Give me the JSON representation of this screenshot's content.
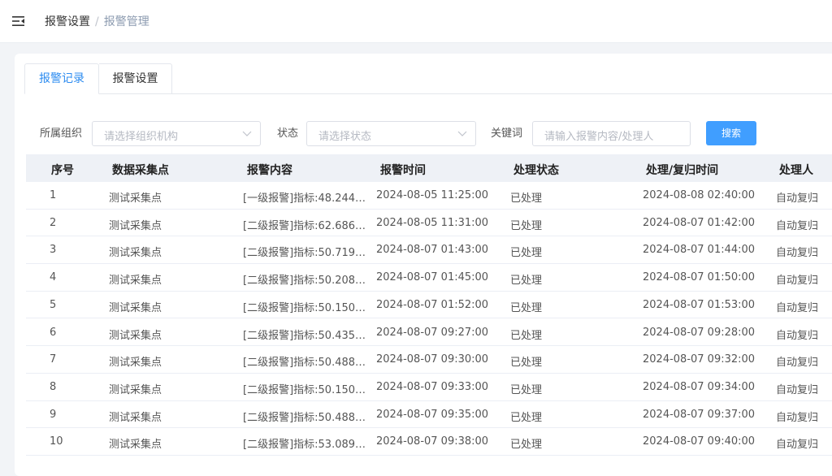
{
  "breadcrumb": {
    "parent": "报警设置",
    "separator": "/",
    "current": "报警管理"
  },
  "tabs": [
    {
      "label": "报警记录",
      "active": true
    },
    {
      "label": "报警设置",
      "active": false
    }
  ],
  "filters": {
    "org_label": "所属组织",
    "org_placeholder": "请选择组织机构",
    "status_label": "状态",
    "status_placeholder": "请选择状态",
    "keyword_label": "关键词",
    "keyword_placeholder": "请输入报警内容/处理人",
    "search_button": "搜索"
  },
  "table": {
    "headers": [
      "序号",
      "数据采集点",
      "报警内容",
      "报警时间",
      "处理状态",
      "处理/复归时间",
      "处理人"
    ],
    "rows": [
      [
        "1",
        "测试采集点",
        "[一级报警]指标:48.244…",
        "2024-08-05 11:25:00",
        "已处理",
        "2024-08-08 02:40:00",
        "自动复归"
      ],
      [
        "2",
        "测试采集点",
        "[二级报警]指标:62.686…",
        "2024-08-05 11:31:00",
        "已处理",
        "2024-08-07 01:42:00",
        "自动复归"
      ],
      [
        "3",
        "测试采集点",
        "[二级报警]指标:50.719…",
        "2024-08-07 01:43:00",
        "已处理",
        "2024-08-07 01:44:00",
        "自动复归"
      ],
      [
        "4",
        "测试采集点",
        "[二级报警]指标:50.208…",
        "2024-08-07 01:45:00",
        "已处理",
        "2024-08-07 01:50:00",
        "自动复归"
      ],
      [
        "5",
        "测试采集点",
        "[二级报警]指标:50.150…",
        "2024-08-07 01:52:00",
        "已处理",
        "2024-08-07 01:53:00",
        "自动复归"
      ],
      [
        "6",
        "测试采集点",
        "[二级报警]指标:50.435…",
        "2024-08-07 09:27:00",
        "已处理",
        "2024-08-07 09:28:00",
        "自动复归"
      ],
      [
        "7",
        "测试采集点",
        "[二级报警]指标:50.488…",
        "2024-08-07 09:30:00",
        "已处理",
        "2024-08-07 09:32:00",
        "自动复归"
      ],
      [
        "8",
        "测试采集点",
        "[二级报警]指标:50.150…",
        "2024-08-07 09:33:00",
        "已处理",
        "2024-08-07 09:34:00",
        "自动复归"
      ],
      [
        "9",
        "测试采集点",
        "[二级报警]指标:50.488…",
        "2024-08-07 09:35:00",
        "已处理",
        "2024-08-07 09:37:00",
        "自动复归"
      ],
      [
        "10",
        "测试采集点",
        "[二级报警]指标:53.089…",
        "2024-08-07 09:38:00",
        "已处理",
        "2024-08-07 09:40:00",
        "自动复归"
      ]
    ]
  },
  "colors": {
    "accent": "#409eff",
    "tab_active": "#2d8cf0",
    "header_bg": "#eef1f6"
  }
}
